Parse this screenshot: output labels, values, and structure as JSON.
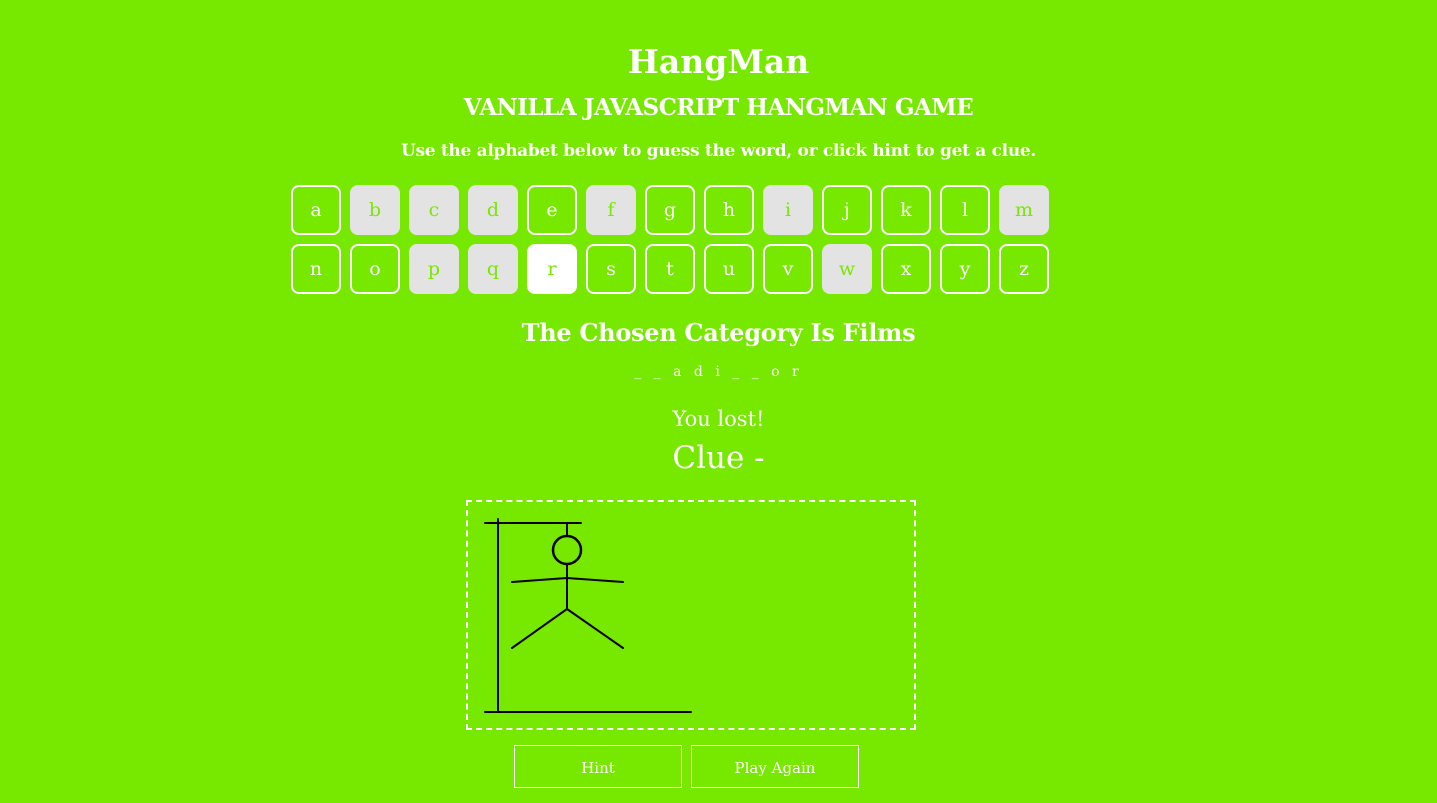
{
  "header": {
    "title": "HangMan",
    "subtitle": "VANILLA JAVASCRIPT HANGMAN GAME",
    "instructions": "Use the alphabet below to guess the word, or click hint to get a clue."
  },
  "alphabet": [
    {
      "letter": "a",
      "state": "available"
    },
    {
      "letter": "b",
      "state": "used"
    },
    {
      "letter": "c",
      "state": "used"
    },
    {
      "letter": "d",
      "state": "used"
    },
    {
      "letter": "e",
      "state": "available"
    },
    {
      "letter": "f",
      "state": "used"
    },
    {
      "letter": "g",
      "state": "available"
    },
    {
      "letter": "h",
      "state": "available"
    },
    {
      "letter": "i",
      "state": "used"
    },
    {
      "letter": "j",
      "state": "available"
    },
    {
      "letter": "k",
      "state": "available"
    },
    {
      "letter": "l",
      "state": "available"
    },
    {
      "letter": "m",
      "state": "used"
    },
    {
      "letter": "n",
      "state": "available"
    },
    {
      "letter": "o",
      "state": "available"
    },
    {
      "letter": "p",
      "state": "used"
    },
    {
      "letter": "q",
      "state": "used"
    },
    {
      "letter": "r",
      "state": "active"
    },
    {
      "letter": "s",
      "state": "available"
    },
    {
      "letter": "t",
      "state": "available"
    },
    {
      "letter": "u",
      "state": "available"
    },
    {
      "letter": "v",
      "state": "available"
    },
    {
      "letter": "w",
      "state": "used"
    },
    {
      "letter": "x",
      "state": "available"
    },
    {
      "letter": "y",
      "state": "available"
    },
    {
      "letter": "z",
      "state": "available"
    }
  ],
  "game": {
    "category": "The Chosen Category Is Films",
    "word_display": "_ _ a d i _ _ o r",
    "status": "You lost!",
    "clue": "Clue -"
  },
  "buttons": {
    "hint_label": "Hint",
    "reset_label": "Play Again"
  },
  "colors": {
    "background": "#77e800",
    "text": "#ffffff",
    "used_letter_bg": "#e3e3e3",
    "drawing_stroke": "#000000"
  }
}
